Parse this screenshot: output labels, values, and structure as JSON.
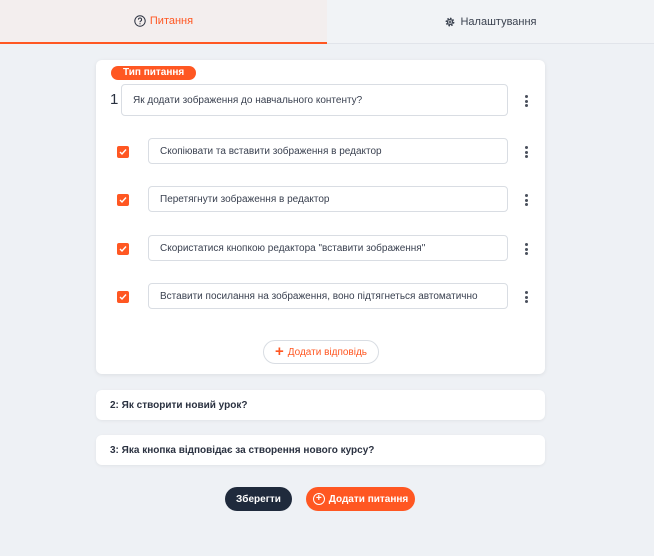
{
  "tabs": {
    "questions": {
      "label": "Питання",
      "icon": "question-circle-icon"
    },
    "settings": {
      "label": "Налаштування",
      "icon": "gear-icon"
    }
  },
  "question1": {
    "type_badge": "Тип питання",
    "number": "1",
    "text": "Як додати зображення до навчального контенту?",
    "answers": [
      {
        "text": "Скопіювати та вставити зображення в редактор",
        "checked": true
      },
      {
        "text": "Перетягнути зображення в редактор",
        "checked": true
      },
      {
        "text": "Скористатися кнопкою редактора \"вставити зображення\"",
        "checked": true
      },
      {
        "text": "Вставити посилання на зображення, воно підтягнеться автоматично",
        "checked": true
      }
    ],
    "add_answer_label": "Додати відповідь"
  },
  "question2": {
    "title": "2: Як створити новий урок?"
  },
  "question3": {
    "title": "3: Яка кнопка відповідає за створення нового курсу?"
  },
  "footer": {
    "save_label": "Зберегти",
    "add_question_label": "Додати питання"
  },
  "colors": {
    "accent": "#ff5722",
    "dark_button": "#1f2a3c",
    "background": "#eef1f5"
  }
}
